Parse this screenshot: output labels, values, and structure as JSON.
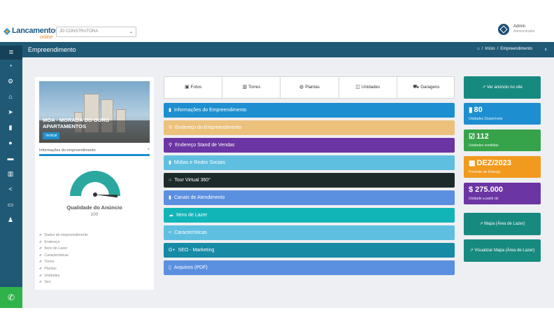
{
  "brand": {
    "logo_main": "Lancamentos",
    "logo_sub": "online"
  },
  "header": {
    "company_select": "JD CONSTRUTORA",
    "user_name": "Admin",
    "user_role": "Administrador"
  },
  "titlebar": {
    "title": "Empreendimento",
    "breadcrumb_home": "Início",
    "breadcrumb_current": "Empreendimento"
  },
  "sidebar": {
    "items": [
      {
        "icon": "dashboard-icon",
        "glyph": "◔"
      },
      {
        "icon": "settings-icon",
        "glyph": "⚙"
      },
      {
        "icon": "bank-icon",
        "glyph": "⌂"
      },
      {
        "icon": "paper-plane-icon",
        "glyph": "➤"
      },
      {
        "icon": "book-icon",
        "glyph": "▮"
      },
      {
        "icon": "comments-icon",
        "glyph": "●"
      },
      {
        "icon": "briefcase-icon",
        "glyph": "▬"
      },
      {
        "icon": "bar-chart-icon",
        "glyph": "▥"
      },
      {
        "icon": "share-icon",
        "glyph": "<"
      },
      {
        "icon": "money-icon",
        "glyph": "▭"
      },
      {
        "icon": "users-icon",
        "glyph": "♟"
      }
    ],
    "whatsapp_icon": "whatsapp-icon"
  },
  "property": {
    "name": "MOA - MORADA DO OURO APARTAMENTOS",
    "type_badge": "Vertical",
    "info_label": "Informações do empreendimento",
    "info_progress": 1.0,
    "quality_label": "Qualidade do Anúncio",
    "quality_value": "100",
    "quality_level": 1.0,
    "checklist": [
      "Dados do empreendimento",
      "Endereço",
      "Itens de Lazer",
      "Características",
      "Torres",
      "Plantas",
      "Unidades",
      "Seo"
    ]
  },
  "tabs": [
    {
      "label": "Fotos",
      "icon": "image-icon",
      "glyph": "▣"
    },
    {
      "label": "Torres",
      "icon": "building-icon",
      "glyph": "▥"
    },
    {
      "label": "Plantas",
      "icon": "globe-icon",
      "glyph": "◍"
    },
    {
      "label": "Unidades",
      "icon": "columns-icon",
      "glyph": "◫"
    },
    {
      "label": "Garagens",
      "icon": "car-icon",
      "glyph": "⛟"
    }
  ],
  "sections": [
    {
      "label": "Informações do Empreendimento",
      "icon": "bookmark-icon",
      "glyph": "▮",
      "color": "#1d8fd0"
    },
    {
      "label": "Endereço do Empreendimento",
      "icon": "map-marker-icon",
      "glyph": "⚲",
      "color": "#ebc17c"
    },
    {
      "label": "Endereço Stand de Vendas",
      "icon": "map-marker-icon",
      "glyph": "⚲",
      "color": "#6b35a3"
    },
    {
      "label": "Mídias e Redes Sociais",
      "icon": "media-icon",
      "glyph": "▮",
      "color": "#5fbfe0"
    },
    {
      "label": "Tour Virtual 360°",
      "icon": "circle-icon",
      "glyph": "○",
      "color": "#1d2b2b"
    },
    {
      "label": "Canais de Atendimento",
      "icon": "headset-icon",
      "glyph": "▮",
      "color": "#5b8fe0"
    },
    {
      "label": "Itens de Lazer",
      "icon": "cloud-icon",
      "glyph": "☁",
      "color": "#11b5b8"
    },
    {
      "label": "Características",
      "icon": "share-icon",
      "glyph": "<",
      "color": "#5fbfe0"
    },
    {
      "label": "SEO - Marketing",
      "icon": "google-plus-icon",
      "glyph": "G+",
      "color": "#178aa6"
    },
    {
      "label": "Arquivos (PDF)",
      "icon": "file-icon",
      "glyph": "▯",
      "color": "#5b8fe0"
    }
  ],
  "actions": {
    "view_ad": "Ver anúncio no site",
    "map_leisure": "Mapa (Área de Lazer)",
    "view_map_leisure": "Visualizar Mapa (Área de Lazer)"
  },
  "stats": [
    {
      "value": "80",
      "label": "Unidades Disponíveis",
      "icon": "building-icon",
      "glyph": "▮",
      "color": "#1d8fd0"
    },
    {
      "value": "112",
      "label": "Unidades vendidas",
      "icon": "check-square-icon",
      "glyph": "☑",
      "color": "#36a34a"
    },
    {
      "value": "DEZ/2023",
      "label": "Previsão de Entrega",
      "icon": "calendar-icon",
      "glyph": "▦",
      "color": "#f19a1e"
    },
    {
      "value": "$ 275.000",
      "label": "Unidade a partir de",
      "icon": "dollar-icon",
      "glyph": "",
      "color": "#6b35a3"
    }
  ],
  "colors": {
    "primary": "#1f5975",
    "action": "#178a7f",
    "gauge": "#2aa8a0"
  }
}
